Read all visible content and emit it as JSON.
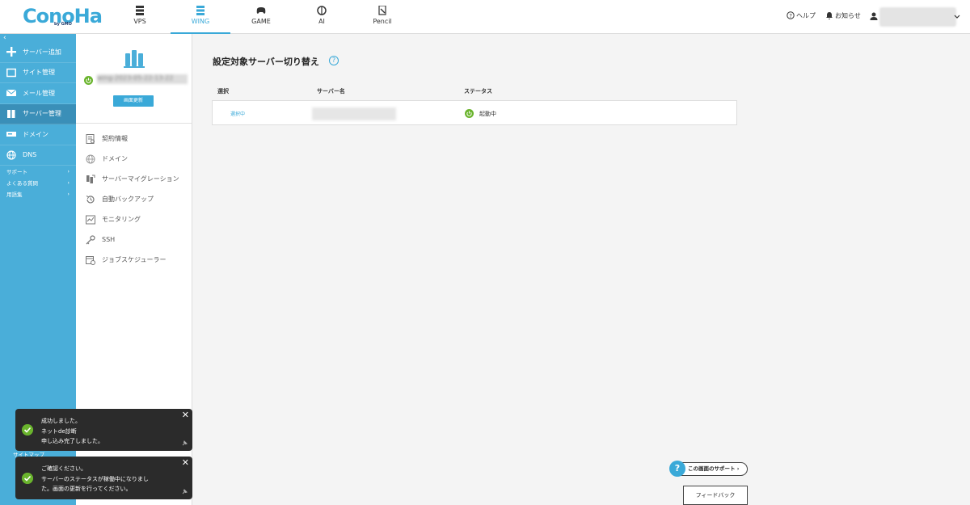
{
  "header": {
    "logo": "ConoHa",
    "logo_sub": "by GMO",
    "tabs": [
      {
        "label": "VPS",
        "icon": "server-icon"
      },
      {
        "label": "WING",
        "icon": "wing-server-icon"
      },
      {
        "label": "GAME",
        "icon": "gamepad-icon"
      },
      {
        "label": "AI",
        "icon": "brain-icon"
      },
      {
        "label": "Pencil",
        "icon": "pencil-icon"
      }
    ],
    "help": "ヘルプ",
    "notice": "お知らせ"
  },
  "sidebar": {
    "collapse": "‹",
    "items": [
      {
        "label": "サーバー追加",
        "icon": "plus-icon"
      },
      {
        "label": "サイト管理",
        "icon": "site-icon"
      },
      {
        "label": "メール管理",
        "icon": "mail-icon"
      },
      {
        "label": "サーバー管理",
        "icon": "server-manage-icon"
      },
      {
        "label": "ドメイン",
        "icon": "domain-icon"
      },
      {
        "label": "DNS",
        "icon": "globe-icon"
      }
    ],
    "links": [
      {
        "label": "サポート"
      },
      {
        "label": "よくある質問"
      },
      {
        "label": "用語集"
      }
    ],
    "sitemap": "サイトマップ"
  },
  "subsidebar": {
    "server_name": "wing-2023-05-22-13-22",
    "refresh": "画面更新",
    "menu": [
      {
        "label": "契約情報",
        "icon": "contract-icon"
      },
      {
        "label": "ドメイン",
        "icon": "globe-icon"
      },
      {
        "label": "サーバーマイグレーション",
        "icon": "migration-icon"
      },
      {
        "label": "自動バックアップ",
        "icon": "backup-icon"
      },
      {
        "label": "モニタリング",
        "icon": "chart-icon"
      },
      {
        "label": "SSH",
        "icon": "key-icon"
      },
      {
        "label": "ジョブスケジューラー",
        "icon": "scheduler-icon"
      }
    ]
  },
  "main": {
    "title": "設定対象サーバー切り替え",
    "columns": [
      "選択",
      "サーバー名",
      "ステータス"
    ],
    "row": {
      "select": "選択中",
      "status": "起動中"
    },
    "support": "この画面のサポート",
    "feedback": "フィードバック"
  },
  "toasts": [
    {
      "lines": [
        "成功しました。",
        "ネットde診断",
        "申し込み完了しました。"
      ]
    },
    {
      "lines": [
        "ご確認ください。",
        "サーバーのステータスが稼働中になりまし",
        "た。画面の更新を行ってください。"
      ]
    }
  ],
  "colors": {
    "accent": "#3aa9d8",
    "sidebar": "#4aaed9",
    "success": "#6ab42d"
  }
}
